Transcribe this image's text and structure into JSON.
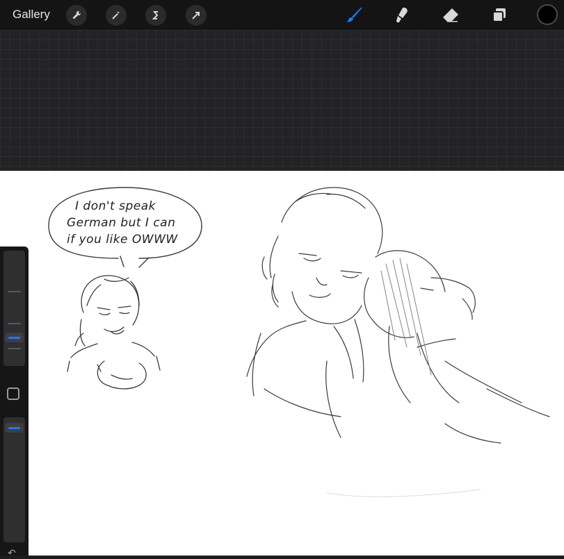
{
  "topbar": {
    "gallery_label": "Gallery",
    "left_tools": [
      {
        "name": "actions-wrench-icon"
      },
      {
        "name": "adjustments-wand-icon"
      },
      {
        "name": "selection-icon"
      },
      {
        "name": "transform-arrow-icon"
      }
    ],
    "right_tools": [
      {
        "name": "brush-icon",
        "active": true
      },
      {
        "name": "smudge-icon",
        "active": false
      },
      {
        "name": "eraser-icon",
        "active": false
      },
      {
        "name": "layers-icon",
        "active": false
      }
    ],
    "active_color": "#1a7bff",
    "current_color": "#000000"
  },
  "canvas": {
    "speech_bubble": {
      "line1": "I don't speak",
      "line2": "German but I can",
      "line3": "if you like OWWW"
    }
  },
  "sidebar": {
    "brush_size_icon": "size-slider",
    "opacity_icon": "opacity-slider",
    "modify_icon": "square-icon",
    "undo_icon": "undo-icon"
  }
}
